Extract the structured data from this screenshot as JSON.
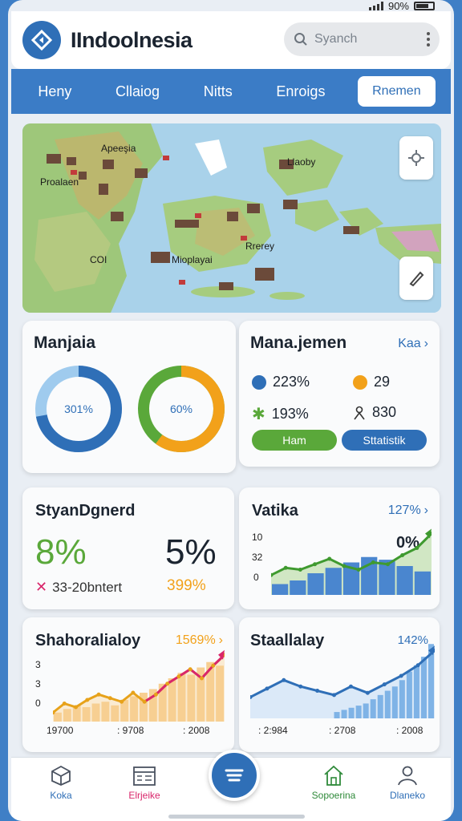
{
  "status": {
    "battery": "90%"
  },
  "header": {
    "title": "IIndoolnesia",
    "search_placeholder": "Syanch"
  },
  "nav": {
    "tabs": [
      {
        "label": "Heny"
      },
      {
        "label": "Cllaiog"
      },
      {
        "label": "Nitts"
      },
      {
        "label": "Enroigs"
      },
      {
        "label": "Rnemen"
      }
    ],
    "active_tab": "Rnemen"
  },
  "map": {
    "labels": {
      "apeesia": "Apeeşia",
      "proalaen": "Proalaen",
      "llaoby": "Llaoby",
      "rrerey": "Rrerey",
      "coi": "COI",
      "mioplayai": "Mioplayai"
    }
  },
  "card_manjaia": {
    "title": "Manjaia",
    "donut1": {
      "label": "301%",
      "fill": 0.72,
      "color": "#2f6fb7",
      "track": "#9fcbee"
    },
    "donut2": {
      "label": "60%",
      "fill": 0.6,
      "color": "#f2a11a",
      "accent": "#5aa83a"
    }
  },
  "card_management": {
    "title": "Mana.jemen",
    "link": "Kaa",
    "stats": [
      {
        "icon": "blue-dot",
        "value": "223%",
        "color": "#2f6fb7"
      },
      {
        "icon": "orange-dot",
        "value": "29",
        "color": "#f2a11a"
      },
      {
        "icon": "star-icon",
        "value": "193%",
        "color": "#5aa83a"
      },
      {
        "icon": "person-icon",
        "value": "830",
        "color": "#333333"
      }
    ],
    "buttons": [
      {
        "label": "Ham",
        "color": "#5aa83a"
      },
      {
        "label": "Sttatistik",
        "color": "#2f6fb7"
      }
    ]
  },
  "card_styan": {
    "title": "StyanDgnerd",
    "value_left": "8%",
    "value_right": "5%",
    "sub_left": "33-20bntert",
    "sub_right": "399%"
  },
  "card_vatika": {
    "title": "Vatika",
    "link": "127%",
    "yticks": [
      "10",
      "32",
      "0"
    ],
    "overlay": "0%",
    "chart_data": {
      "type": "bar",
      "bars": [
        1.2,
        1.6,
        2.4,
        3.0,
        3.6,
        4.2,
        3.9,
        3.2,
        2.6
      ],
      "line": [
        2.2,
        3.0,
        2.8,
        3.4,
        4.0,
        3.2,
        2.8,
        3.6,
        3.4,
        4.4,
        5.2,
        6.8
      ],
      "ylim": [
        0,
        8
      ]
    }
  },
  "card_shahor": {
    "title": "Shahoralialoy",
    "link": "1569%",
    "yticks": [
      "3",
      "3",
      "0"
    ],
    "xticks": [
      "19700",
      ": 9708",
      ": 2008"
    ],
    "chart_data": {
      "type": "bar",
      "bars": [
        1.0,
        1.4,
        1.8,
        1.6,
        2.0,
        2.2,
        1.8,
        2.4,
        2.8,
        3.2,
        3.6,
        4.2,
        4.8,
        5.4,
        5.2,
        6.0,
        6.6,
        6.2
      ],
      "line": [
        1.0,
        2.0,
        1.6,
        2.4,
        3.0,
        2.6,
        2.2,
        3.2,
        2.2,
        3.0,
        4.2,
        5.0,
        5.8,
        4.8,
        6.2,
        7.4
      ],
      "ylim": [
        0,
        8
      ]
    }
  },
  "card_stallalay": {
    "title": "Staallalay",
    "link": "142%",
    "xticks": [
      ": 2:984",
      ": 2708",
      ": 2008"
    ],
    "chart_data": {
      "type": "bar",
      "bars": [
        0.6,
        0.8,
        1.0,
        1.2,
        1.4,
        1.8,
        2.2,
        2.6,
        3.0,
        3.6,
        4.4,
        5.0,
        5.8,
        7.0
      ],
      "line": [
        2.0,
        2.8,
        3.6,
        3.0,
        2.6,
        2.2,
        3.0,
        2.4,
        3.2,
        4.0,
        5.0,
        6.4
      ],
      "ylim": [
        0,
        8
      ]
    }
  },
  "bottom_nav": {
    "items": [
      {
        "label": "Koka",
        "icon": "cube-icon",
        "color": "#2f6fb7"
      },
      {
        "label": "Elrjeike",
        "icon": "calendar-icon",
        "color": "#d9266b"
      },
      {
        "label": "Sopoerina",
        "icon": "home-icon",
        "color": "#2f8a3a"
      },
      {
        "label": "Dlaneko",
        "icon": "user-icon",
        "color": "#2f6fb7"
      }
    ]
  }
}
